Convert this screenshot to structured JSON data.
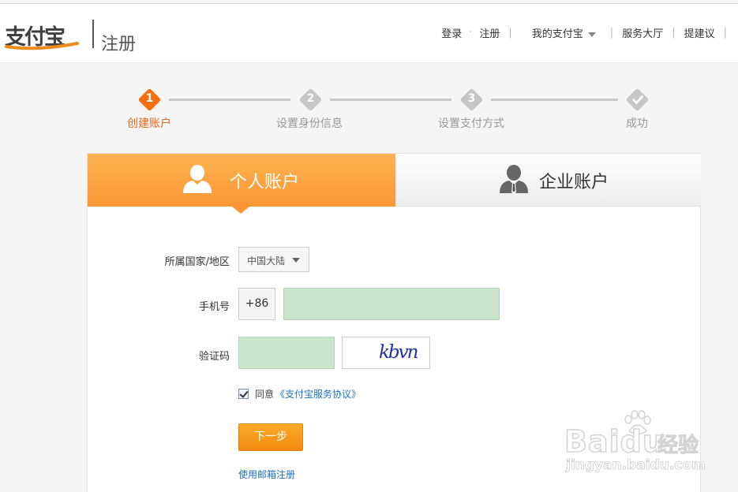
{
  "header": {
    "logo_text": "支付宝",
    "title": "注册",
    "nav": {
      "login": "登录",
      "register": "注册",
      "my_alipay": "我的支付宝",
      "service_hall": "服务大厅",
      "suggest": "提建议"
    }
  },
  "steps": [
    {
      "num": "1",
      "label": "创建账户",
      "state": "active"
    },
    {
      "num": "2",
      "label": "设置身份信息",
      "state": "pending"
    },
    {
      "num": "3",
      "label": "设置支付方式",
      "state": "pending"
    },
    {
      "num": "",
      "label": "成功",
      "state": "pending",
      "icon": "check-icon"
    }
  ],
  "tabs": {
    "personal": "个人账户",
    "business": "企业账户"
  },
  "form": {
    "country_label": "所属国家/地区",
    "country_value": "中国大陆",
    "phone_label": "手机号",
    "phone_prefix": "+86",
    "phone_value": "",
    "captcha_label": "验证码",
    "captcha_value": "",
    "captcha_text": "kbvn",
    "agree_text": "同意",
    "agreement_link": "《支付宝服务协议》",
    "agree_checked": true,
    "next_button": "下一步",
    "email_register_link": "使用邮箱注册"
  },
  "watermark": {
    "brand": "Baidu",
    "brand_cn": "经验",
    "url": "jingyan.baidu.com"
  },
  "colors": {
    "accent_orange": "#f66f0f",
    "tab_orange": "#fb9634",
    "link_blue": "#1a6fc2",
    "input_green": "#c9e6cc"
  }
}
